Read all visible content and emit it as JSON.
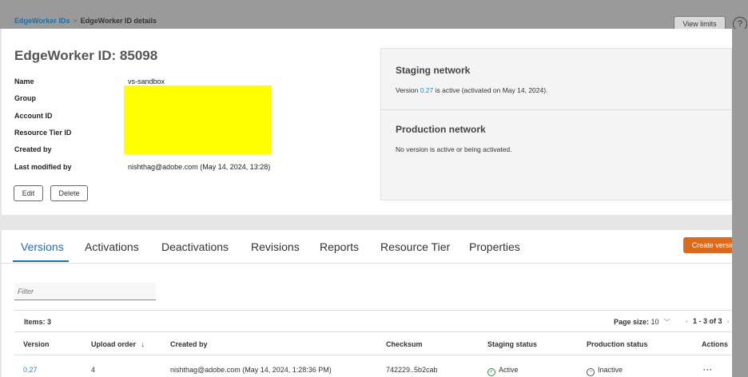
{
  "breadcrumb": {
    "link": "EdgeWorker IDs",
    "separator": ">",
    "current": "EdgeWorker ID details"
  },
  "header": {
    "view_limits": "View limits",
    "help": "?"
  },
  "title": "EdgeWorker ID: 85098",
  "details": [
    {
      "label": "Name",
      "value": "vs-sandbox"
    },
    {
      "label": "Group",
      "value": ""
    },
    {
      "label": "Account ID",
      "value": ""
    },
    {
      "label": "Resource Tier ID",
      "value": ""
    },
    {
      "label": "Created by",
      "value": ""
    },
    {
      "label": "Last modified by",
      "value": "nishthag@adobe.com (May 14, 2024, 13:28)"
    }
  ],
  "buttons": {
    "edit": "Edit",
    "delete": "Delete"
  },
  "staging": {
    "title": "Staging network",
    "prefix": "Version ",
    "version": "0.27",
    "suffix": " is active (activated on May 14, 2024)."
  },
  "production": {
    "title": "Production network",
    "text": "No version is active or being activated."
  },
  "tabs": [
    "Versions",
    "Activations",
    "Deactivations",
    "Revisions",
    "Reports",
    "Resource Tier",
    "Properties"
  ],
  "create_version": "Create version",
  "filter_placeholder": "Filter",
  "items": "Items: 3",
  "page_size": {
    "label": "Page size:",
    "value": "10"
  },
  "pager": {
    "range": "1 - 3 of 3"
  },
  "columns": [
    "Version",
    "Upload order",
    "Created by",
    "Checksum",
    "Staging status",
    "Production status",
    "Actions"
  ],
  "rows": [
    {
      "version": "0.27",
      "upload_order": "4",
      "created_by": "nishthag@adobe.com (May 14, 2024, 1:28:36 PM)",
      "checksum": "742229..5b2cab",
      "staging_status": "Active",
      "production_status": "Inactive",
      "actions": "···"
    }
  ],
  "colors": {
    "accent": "#1e6fa6",
    "create_button": "#d96a1e",
    "active": "#2e8b3a",
    "redaction": "#ffff00"
  }
}
